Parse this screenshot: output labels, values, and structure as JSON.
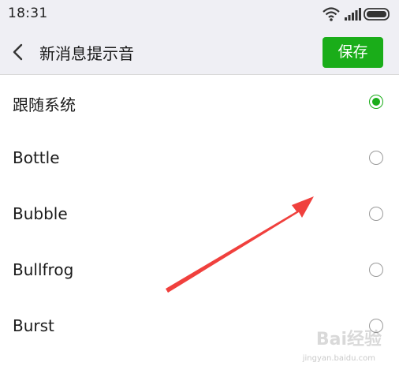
{
  "status_bar": {
    "time": "18:31",
    "icons": [
      "wifi-icon",
      "signal-icon",
      "battery-icon"
    ]
  },
  "nav_bar": {
    "back_icon": "chevron-left-icon",
    "title": "新消息提示音",
    "save_label": "保存"
  },
  "sounds": [
    {
      "label": "跟随系统",
      "selected": true
    },
    {
      "label": "Bottle",
      "selected": false
    },
    {
      "label": "Bubble",
      "selected": false
    },
    {
      "label": "Bullfrog",
      "selected": false
    },
    {
      "label": "Burst",
      "selected": false
    }
  ],
  "watermark": {
    "brand": "Bai经验",
    "url": "jingyan.baidu.com"
  },
  "colors": {
    "accent": "#1aad19",
    "arrow": "#f0403d",
    "header_bg": "#efeff4"
  }
}
